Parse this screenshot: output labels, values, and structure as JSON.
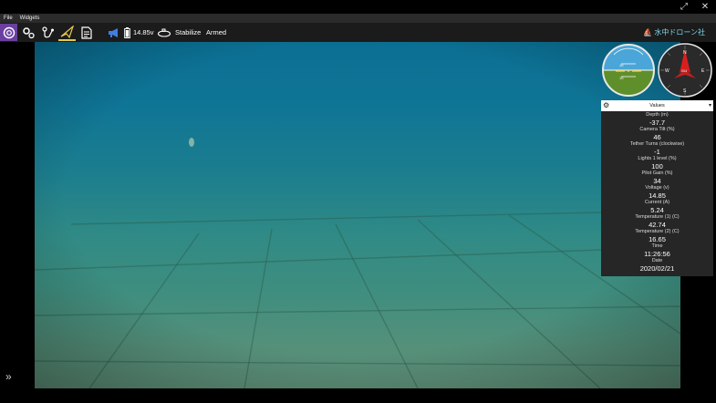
{
  "menu": {
    "file": "File",
    "widgets": "Widgets"
  },
  "window": {
    "restore_glyph": "⤢",
    "close_glyph": "✕"
  },
  "toolbar": {
    "voltage": "14.85v",
    "mode": "Stabilize",
    "arm_state": "Armed",
    "brand": "水中ドローン社",
    "brand_glyph": "⛵"
  },
  "sidebar": {
    "expand_glyph": "»"
  },
  "compass": {
    "n": "N",
    "s": "S",
    "e": "E",
    "w": "W",
    "heading": "004"
  },
  "horizon": {
    "pitch_upper": "10",
    "pitch_lower": "10"
  },
  "values_panel": {
    "title": "Values",
    "items": [
      {
        "label": "Depth (m)",
        "value": "-37.7"
      },
      {
        "label": "Camera Tilt (%)",
        "value": "46"
      },
      {
        "label": "Tether Turns (clockwise)",
        "value": "-1"
      },
      {
        "label": "Lights 1 level (%)",
        "value": "100"
      },
      {
        "label": "Pilot Gain (%)",
        "value": "34"
      },
      {
        "label": "Voltage (v)",
        "value": "14.85"
      },
      {
        "label": "Current (A)",
        "value": "5.24"
      },
      {
        "label": "Temperature (1) (C)",
        "value": "42.74"
      },
      {
        "label": "Temperature (2) (C)",
        "value": "16.65"
      },
      {
        "label": "Time",
        "value": "11:26:56"
      },
      {
        "label": "Date",
        "value": "2020/02/21"
      }
    ]
  },
  "colors": {
    "accent": "#6b3fa0",
    "brand": "#7fd6e8",
    "horizon_sky": "#4aa6d8",
    "horizon_ground": "#5f8f2a",
    "compass_needle": "#d81f1f"
  }
}
